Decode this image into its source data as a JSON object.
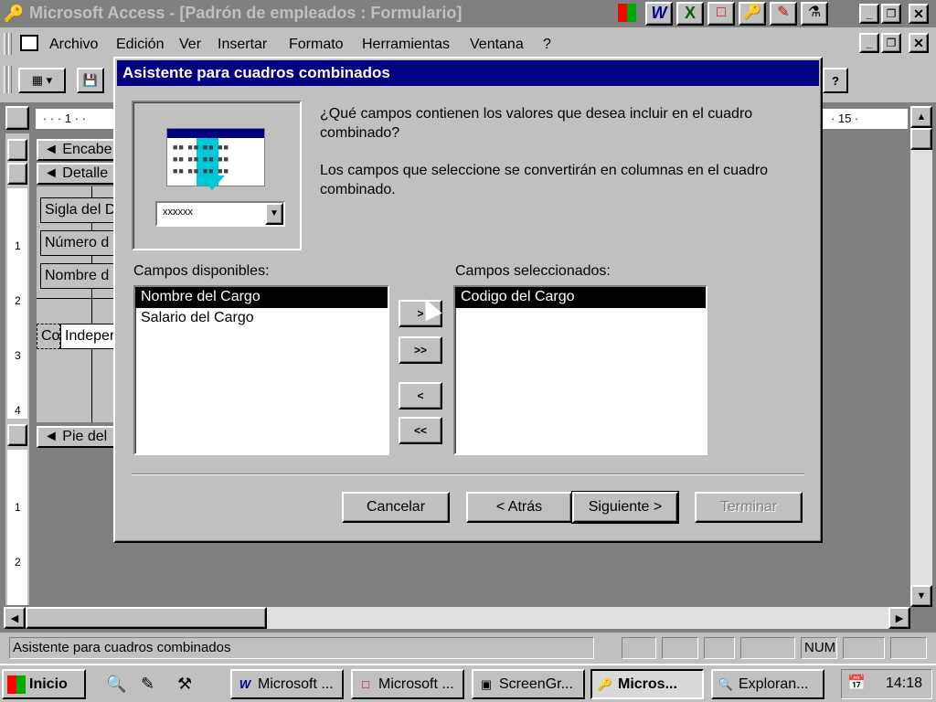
{
  "app": {
    "title": "Microsoft Access - [Padrón de empleados : Formulario]"
  },
  "menu": [
    {
      "label": "Archivo"
    },
    {
      "label": "Edición"
    },
    {
      "label": "Ver"
    },
    {
      "label": "Insertar"
    },
    {
      "label": "Formato"
    },
    {
      "label": "Herramientas"
    },
    {
      "label": "Ventana"
    },
    {
      "label": "?"
    }
  ],
  "ruler": {
    "top_left": "· · · 1 · ·",
    "top_right": "· 15 ·"
  },
  "design": {
    "header_section": "Encabe",
    "detail_section": "Detalle",
    "footer_section": "Pie del",
    "label1": "Sigla del D",
    "label2": "Número d",
    "label3": "Nombre d",
    "combo_label": "Co",
    "combo_value": "Indeper",
    "ruler_numbers": [
      "1",
      "2",
      "3",
      "4",
      "1",
      "2"
    ]
  },
  "dialog": {
    "title": "Asistente para cuadros combinados",
    "preview_placeholder": "xxxxxx",
    "question": "¿Qué campos contienen los valores que desea incluir en el cuadro combinado?",
    "info": "Los campos que seleccione se convertirán en columnas en el cuadro combinado.",
    "available_label": "Campos disponibles:",
    "selected_label": "Campos seleccionados:",
    "available_fields": [
      "Nombre del Cargo",
      "Salario del Cargo"
    ],
    "selected_fields": [
      "Codigo del Cargo"
    ],
    "move_one_right": ">",
    "move_all_right": ">>",
    "move_one_left": "<",
    "move_all_left": "<<",
    "cancel": "Cancelar",
    "back": "< Atrás",
    "next": "Siguiente >",
    "finish": "Terminar"
  },
  "status": {
    "text": "Asistente para cuadros combinados",
    "num": "NUM"
  },
  "taskbar": {
    "start": "Inicio",
    "tasks": [
      {
        "label": "Microsoft ...",
        "icon": "word-icon"
      },
      {
        "label": "Microsoft ...",
        "icon": "powerpoint-icon"
      },
      {
        "label": "ScreenGr...",
        "icon": "screen-icon"
      },
      {
        "label": "Micros...",
        "icon": "access-key-icon"
      },
      {
        "label": "Exploran...",
        "icon": "explorer-icon"
      }
    ],
    "clock": "14:18"
  },
  "colors": {
    "title_bar_inactive": "#808080",
    "dialog_title": "#000080",
    "selection": "#000000",
    "desktop_gray": "#c0c0c0"
  }
}
